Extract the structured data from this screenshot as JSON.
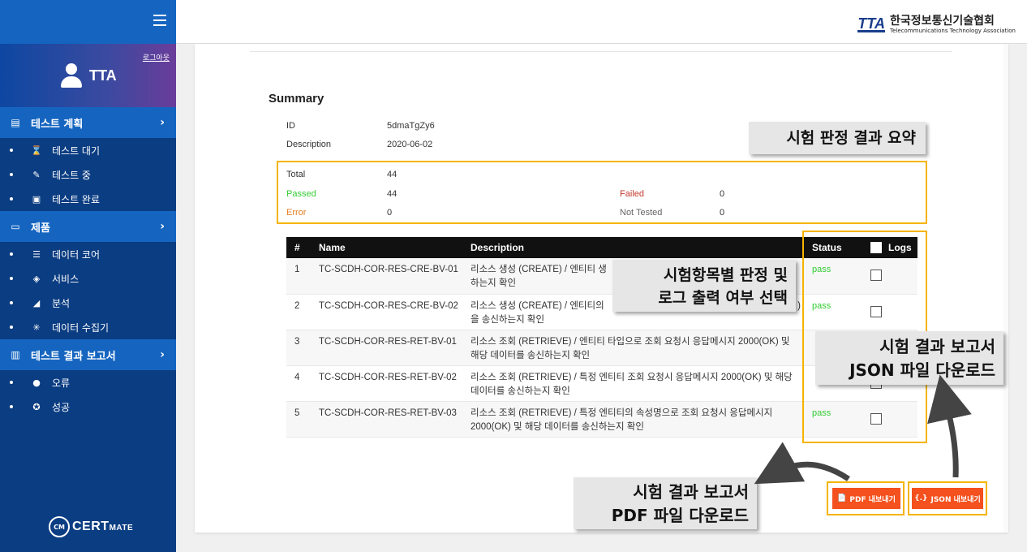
{
  "sidebar": {
    "logout": "로그아웃",
    "user": "TTA",
    "sections": [
      {
        "label": "테스트 계획",
        "items": [
          {
            "label": "테스트 대기"
          },
          {
            "label": "테스트 중"
          },
          {
            "label": "테스트 완료"
          }
        ]
      },
      {
        "label": "제품",
        "items": [
          {
            "label": "데이터 코어"
          },
          {
            "label": "서비스"
          },
          {
            "label": "분석"
          },
          {
            "label": "데이터 수집기"
          }
        ]
      },
      {
        "label": "테스트 결과 보고서",
        "items": [
          {
            "label": "오류"
          },
          {
            "label": "성공"
          }
        ]
      }
    ],
    "logo_cm": "CM",
    "logo_text": "CERT",
    "logo_small": "MATE"
  },
  "header": {
    "tta_mark": "TTA",
    "tta_ko": "한국정보통신기술협회",
    "tta_en": "Telecommunications Technology Association"
  },
  "summary": {
    "title": "Summary",
    "id_label": "ID",
    "id_value": "5dmaTgZy6",
    "desc_label": "Description",
    "desc_value": "2020-06-02",
    "total_label": "Total",
    "total_value": "44",
    "passed_label": "Passed",
    "passed_value": "44",
    "failed_label": "Failed",
    "failed_value": "0",
    "error_label": "Error",
    "error_value": "0",
    "nottested_label": "Not Tested",
    "nottested_value": "0"
  },
  "table": {
    "headers": {
      "num": "#",
      "name": "Name",
      "desc": "Description",
      "status": "Status",
      "logs": "Logs"
    },
    "rows": [
      {
        "num": "1",
        "name": "TC-SCDH-COR-RES-CRE-BV-01",
        "desc1": "리소스 생성 (CREATE) / 엔티티 생",
        "desc2": "하는지 확인",
        "status": "pass"
      },
      {
        "num": "2",
        "name": "TC-SCDH-COR-RES-CRE-BV-02",
        "desc1": "리소스 생성 (CREATE) / 엔티티의",
        "desc2": "을 송신하는지 확인",
        "desc_end": ")",
        "status": "pass"
      },
      {
        "num": "3",
        "name": "TC-SCDH-COR-RES-RET-BV-01",
        "desc1": "리소스 조회 (RETRIEVE) / 엔티티 타입으로 조회 요청시 응답메시지 2000(OK) 및",
        "desc2": "해당 데이터를 송신하는지 확인",
        "status": ""
      },
      {
        "num": "4",
        "name": "TC-SCDH-COR-RES-RET-BV-02",
        "desc1": "리소스 조회 (RETRIEVE) / 특정 엔티티 조회 요청시 응답메시지 2000(OK) 및 해당",
        "desc2": "데이터를 송신하는지 확인",
        "status": ""
      },
      {
        "num": "5",
        "name": "TC-SCDH-COR-RES-RET-BV-03",
        "desc1": "리소스 조회 (RETRIEVE) / 특정 엔티티의 속성명으로 조회 요청시 응답메시지",
        "desc2": "2000(OK) 및 해당 데이터를 송신하는지 확인",
        "status": "pass"
      }
    ]
  },
  "callouts": {
    "summary": "시험 판정 결과 요약",
    "select1": "시험항목별 판정 및",
    "select2": "로그 출력 여부 선택",
    "json1": "시험 결과 보고서",
    "json2": "JSON 파일 다운로드",
    "pdf1": "시험 결과 보고서",
    "pdf2": "PDF 파일 다운로드"
  },
  "buttons": {
    "pdf_icon": "📄",
    "pdf": "PDF 내보내기",
    "json_icon": "{.}",
    "json": "JSON 내보내기"
  },
  "colors": {
    "accent": "#1565c0",
    "sidebar": "#0b3d82",
    "button": "#f4511e",
    "highlight": "#f5b400",
    "pass": "#33cc33"
  }
}
